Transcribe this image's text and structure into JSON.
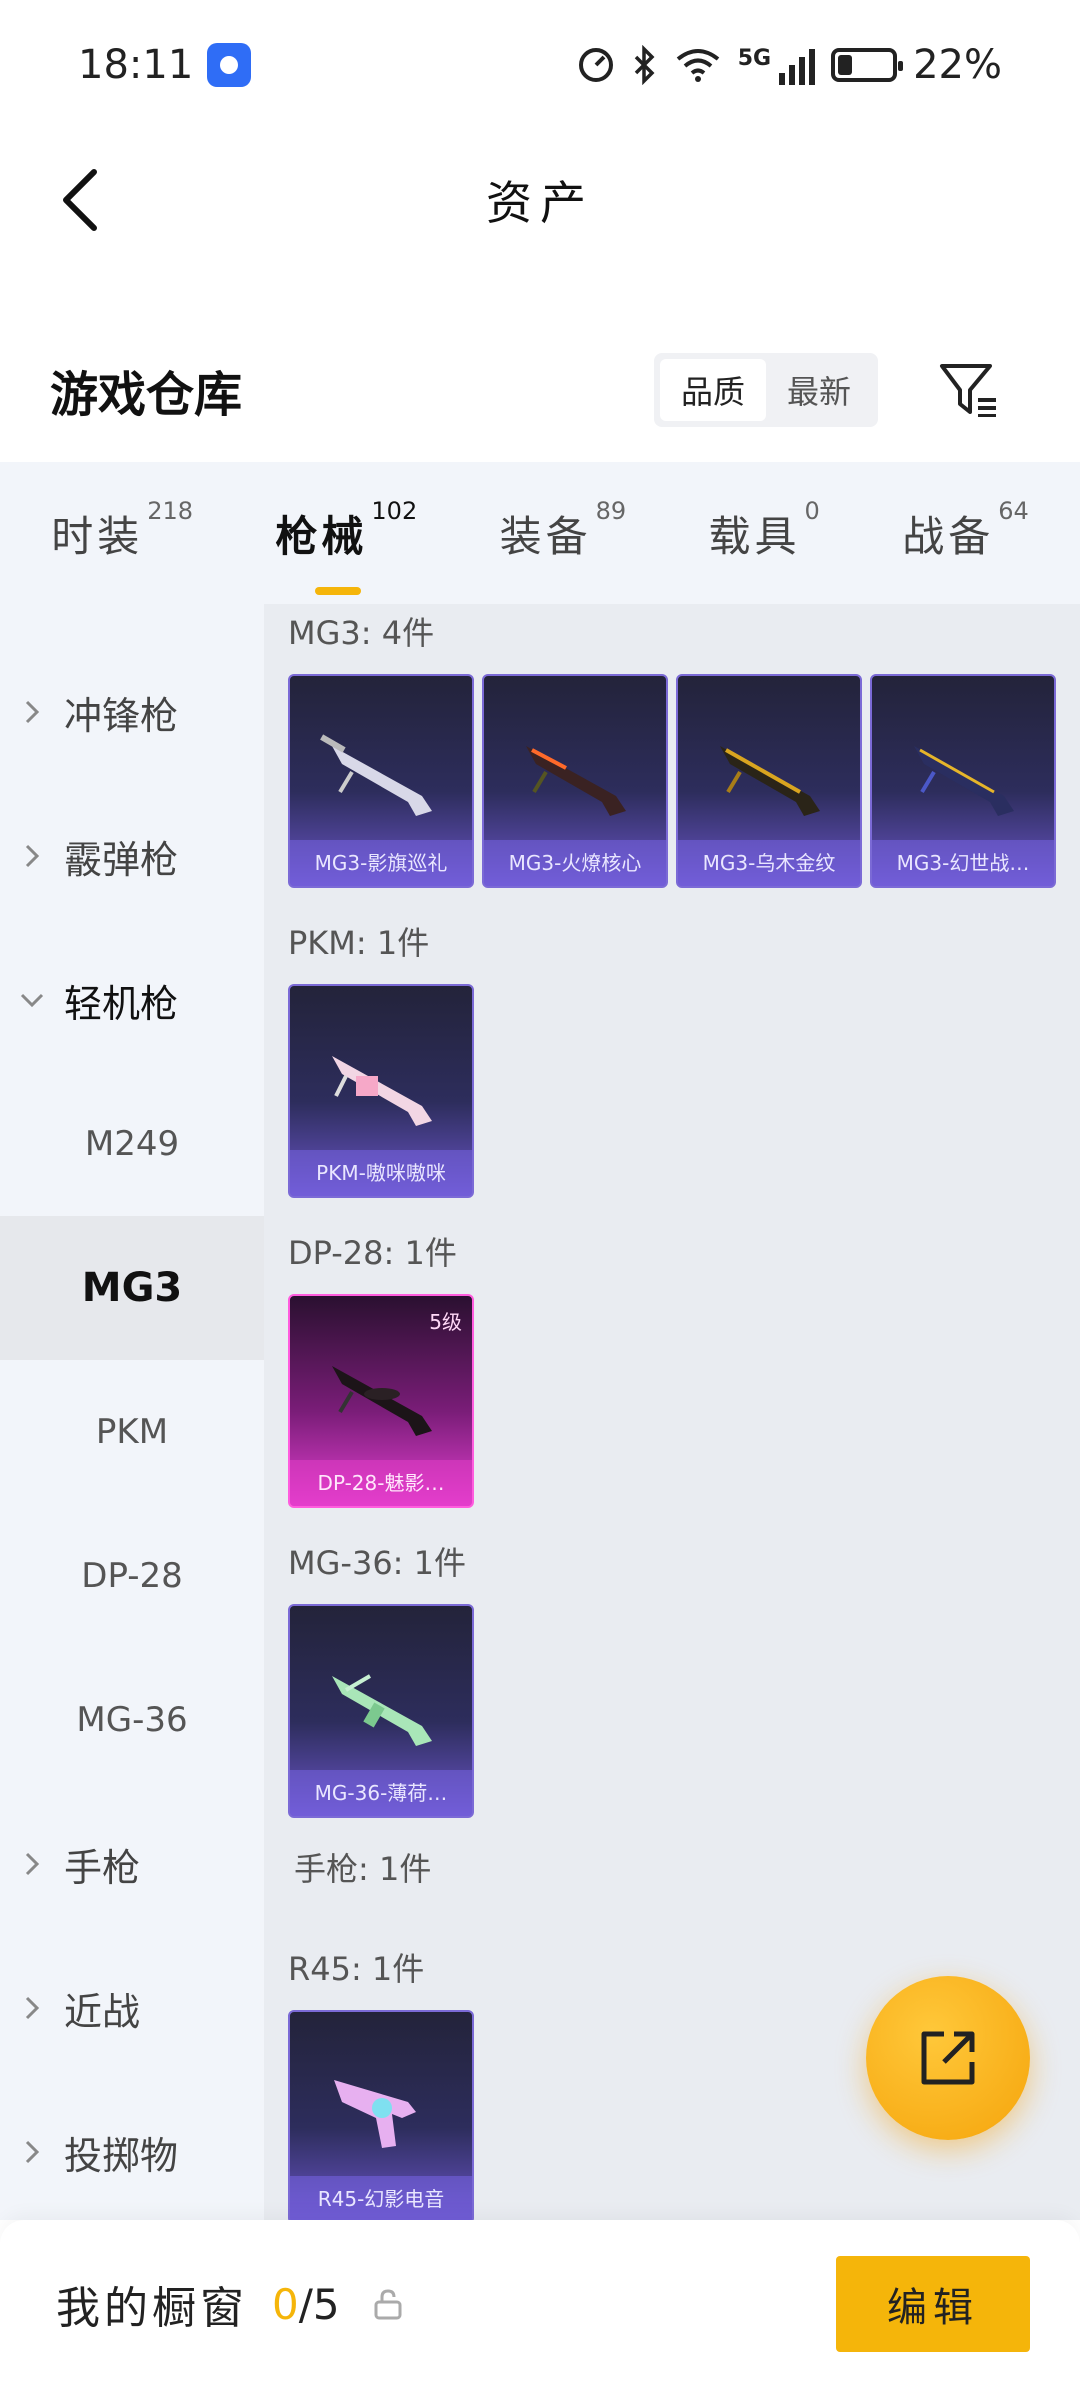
{
  "status_bar": {
    "time": "18:11",
    "network": "5G",
    "battery": "22%"
  },
  "header": {
    "title": "资产"
  },
  "warehouse": {
    "title": "游戏仓库",
    "sort_options": [
      "品质",
      "最新"
    ],
    "active_sort": "品质"
  },
  "tabs": [
    {
      "label": "时装",
      "count": "218"
    },
    {
      "label": "枪械",
      "count": "102"
    },
    {
      "label": "装备",
      "count": "89"
    },
    {
      "label": "载具",
      "count": "0"
    },
    {
      "label": "战备",
      "count": "64"
    }
  ],
  "sidebar": {
    "categories": [
      {
        "label": "冲锋枪",
        "expanded": false
      },
      {
        "label": "霰弹枪",
        "expanded": false
      },
      {
        "label": "轻机枪",
        "expanded": true
      },
      {
        "label": "手枪",
        "expanded": false
      },
      {
        "label": "近战",
        "expanded": false
      },
      {
        "label": "投掷物",
        "expanded": false
      }
    ],
    "sub_items": [
      "M249",
      "MG3",
      "PKM",
      "DP-28",
      "MG-36"
    ],
    "selected": "MG3"
  },
  "content": {
    "groups": [
      {
        "label": "MG3: 4件",
        "items": [
          "MG3-影旗巡礼",
          "MG3-火燎核心",
          "MG3-乌木金纹",
          "MG3-幻世战…"
        ]
      },
      {
        "label": "PKM: 1件",
        "items": [
          "PKM-嗷咪嗷咪"
        ]
      },
      {
        "label": "DP-28: 1件",
        "items": [
          "DP-28-魅影…"
        ],
        "grade": "5级"
      },
      {
        "label": "MG-36: 1件",
        "items": [
          "MG-36-薄荷…"
        ]
      },
      {
        "label": "手枪: 1件",
        "items": []
      },
      {
        "label": "R45: 1件",
        "items": [
          "R45-幻影电音"
        ]
      }
    ]
  },
  "bottom_bar": {
    "window_label": "我的橱窗",
    "count_current": "0",
    "count_total": "/5",
    "edit_label": "编辑"
  },
  "colors": {
    "accent": "#f5b50a",
    "card_purple": "#6a55c8",
    "card_pink": "#e23fd0"
  }
}
